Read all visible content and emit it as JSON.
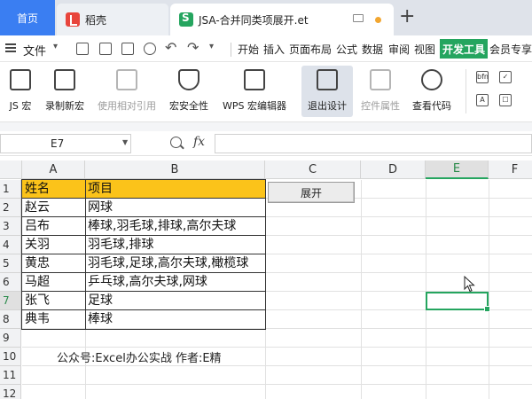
{
  "tabs": {
    "home": "首页",
    "doc1": "稻壳",
    "active": "JSA-合并同类项展开.et"
  },
  "menubar": {
    "file": "文件",
    "items": [
      "开始",
      "插入",
      "页面布局",
      "公式",
      "数据",
      "审阅",
      "视图"
    ],
    "active": "开发工具",
    "trailing": "会员专享"
  },
  "ribbon": {
    "buttons": [
      "JS 宏",
      "录制新宏",
      "使用相对引用",
      "宏安全性",
      "WPS 宏编辑器",
      "退出设计",
      "控件属性",
      "查看代码"
    ],
    "mini_icons": [
      "bfn",
      "✓",
      "A",
      "☐"
    ]
  },
  "formula_bar": {
    "cell_ref": "E7",
    "fx": "fx",
    "value": ""
  },
  "sheet": {
    "columns": [
      "A",
      "B",
      "C",
      "D",
      "E",
      "F"
    ],
    "rows": [
      "1",
      "2",
      "3",
      "4",
      "5",
      "6",
      "7",
      "8",
      "9",
      "10",
      "11",
      "12"
    ],
    "selected_cell": "E7",
    "header": {
      "name": "姓名",
      "item": "项目"
    },
    "data": [
      {
        "name": "赵云",
        "item": "网球"
      },
      {
        "name": "吕布",
        "item": "棒球,羽毛球,排球,高尔夫球"
      },
      {
        "name": "关羽",
        "item": "羽毛球,排球"
      },
      {
        "name": "黄忠",
        "item": "羽毛球,足球,高尔夫球,橄榄球"
      },
      {
        "name": "马超",
        "item": "乒乓球,高尔夫球,网球"
      },
      {
        "name": "张飞",
        "item": "足球"
      },
      {
        "name": "典韦",
        "item": "棒球"
      }
    ],
    "button_label": "展开",
    "caption": "公众号:Excel办公实战 作者:E精"
  },
  "colors": {
    "accent": "#25a55f",
    "tab_home": "#3a7ef2",
    "header_fill": "#fbc31a"
  }
}
